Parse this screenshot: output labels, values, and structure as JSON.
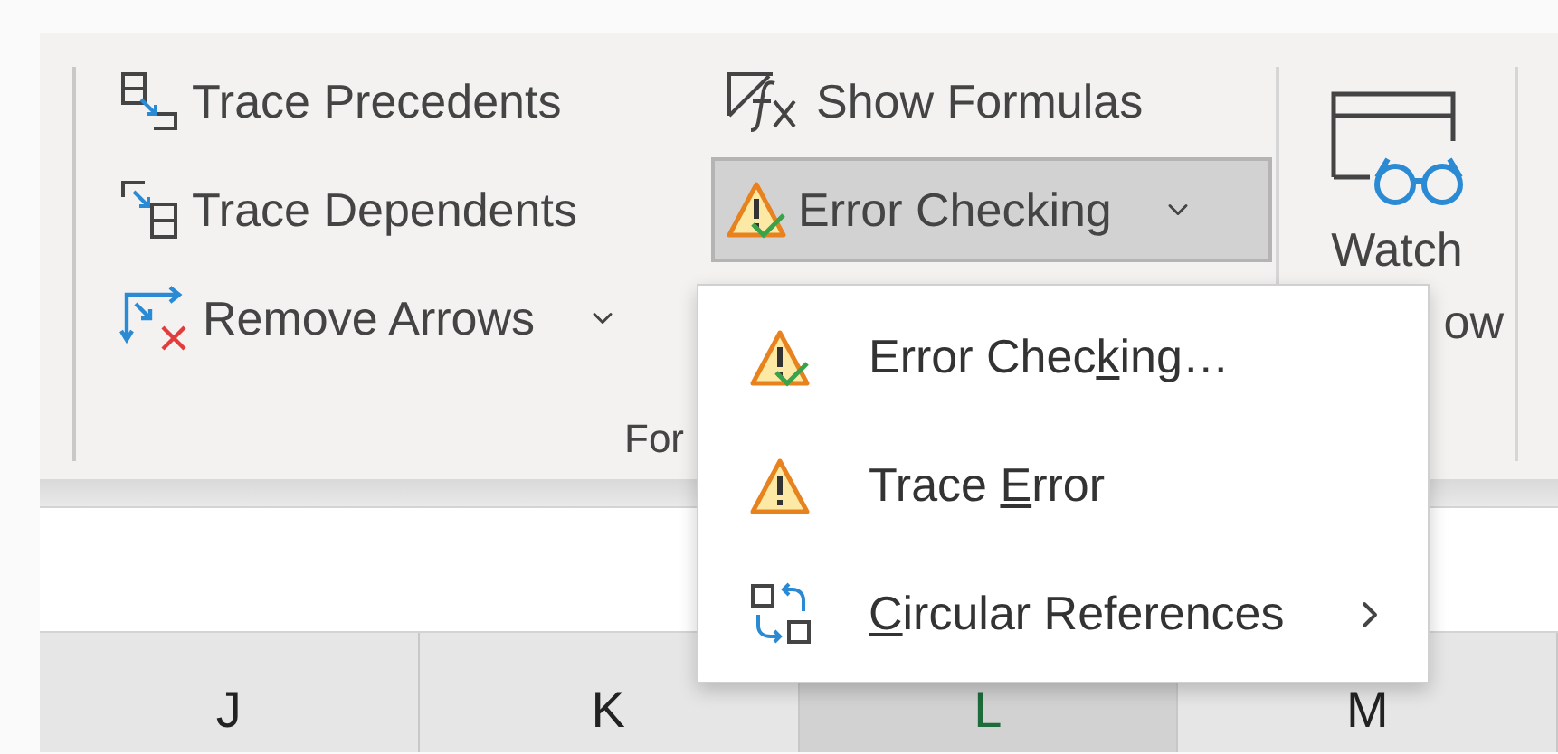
{
  "ribbon": {
    "columns": [
      [
        {
          "kind": "trace-precedents",
          "label": "Trace Precedents",
          "dropdown": false,
          "pressed": false
        },
        {
          "kind": "trace-dependents",
          "label": "Trace Dependents",
          "dropdown": false,
          "pressed": false
        },
        {
          "kind": "remove-arrows",
          "label": "Remove Arrows",
          "dropdown": true,
          "pressed": false
        }
      ],
      [
        {
          "kind": "show-formulas",
          "label": "Show Formulas",
          "dropdown": false,
          "pressed": false
        },
        {
          "kind": "error-checking",
          "label": "Error Checking",
          "dropdown": true,
          "pressed": true
        }
      ]
    ],
    "group_label": "For",
    "watch_window": {
      "line_1": "Watch",
      "line_2": "ow"
    }
  },
  "menu": {
    "items": [
      {
        "kind": "error-checking",
        "label_start": "Error Chec",
        "access_key": "k",
        "label_end": "ing…",
        "submenu": false
      },
      {
        "kind": "trace-error",
        "label_start": "Trace ",
        "access_key": "E",
        "label_end": "rror",
        "submenu": false
      },
      {
        "kind": "circular-references",
        "access_key": "C",
        "label_end": "ircular References",
        "submenu": true
      }
    ]
  },
  "column_headers": [
    {
      "label": "J",
      "selected": false
    },
    {
      "label": "K",
      "selected": false
    },
    {
      "label": "L",
      "selected": true
    },
    {
      "label": "M",
      "selected": false
    }
  ]
}
